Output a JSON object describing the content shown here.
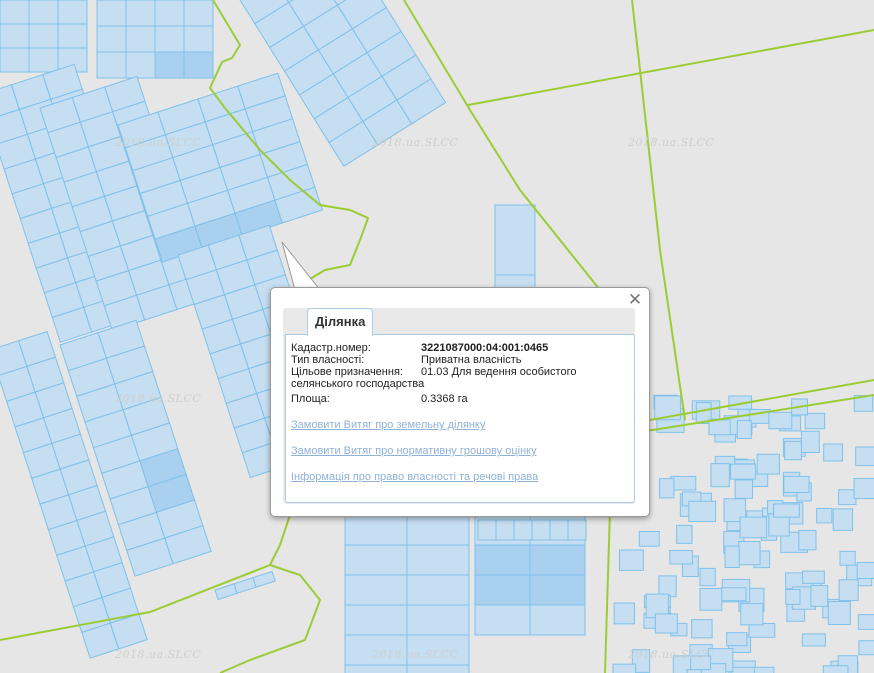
{
  "map": {
    "watermark": "2018.ua.SLCC",
    "colors": {
      "background": "#e6e6e6",
      "parcel_fill": "#c6def1",
      "parcel_fill_selected": "#a9d0ef",
      "parcel_stroke": "#7fc1ea",
      "boundary_line": "#9ccc35"
    }
  },
  "popup": {
    "tab_label": "Ділянка",
    "close_icon": "close-icon",
    "fields": [
      {
        "label": "Кадастр.номер:",
        "value": "3221087000:04:001:0465"
      },
      {
        "label": "Тип власності:",
        "value": "Приватна власність"
      },
      {
        "label": "Цільове призначення:",
        "value": "01.03 Для ведення особистого селянського господарства"
      },
      {
        "label": "Площа:",
        "value": "0.3368 га"
      }
    ],
    "links": [
      "Замовити Витяг про земельну ділянку",
      "Замовити Витяг про нормативну грошову оцінку",
      "Інформація про право власності та речові права"
    ]
  }
}
